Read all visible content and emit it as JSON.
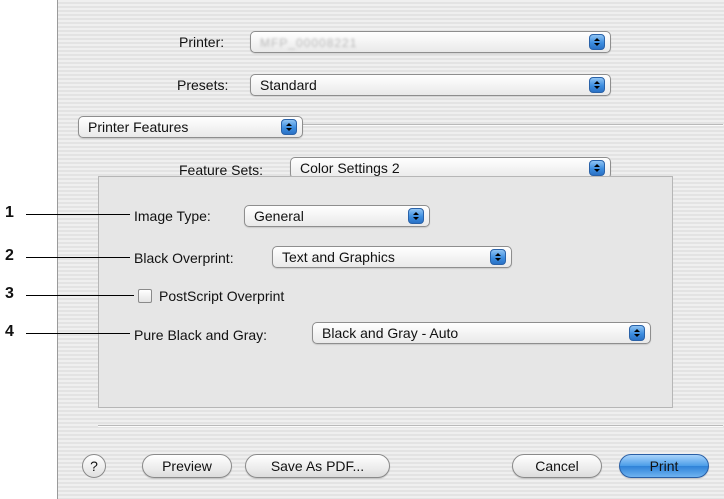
{
  "header": {
    "printer_label": "Printer:",
    "printer_value": "MFP_00008221",
    "presets_label": "Presets:",
    "presets_value": "Standard"
  },
  "panel_select": {
    "value": "Printer Features"
  },
  "feature_sets": {
    "label": "Feature Sets:",
    "value": "Color Settings 2"
  },
  "settings": {
    "image_type_label": "Image Type:",
    "image_type_value": "General",
    "black_overprint_label": "Black Overprint:",
    "black_overprint_value": "Text and Graphics",
    "postscript_overprint_label": "PostScript Overprint",
    "postscript_overprint_checked": false,
    "pure_black_label": "Pure Black and Gray:",
    "pure_black_value": "Black and Gray - Auto"
  },
  "callouts": [
    "1",
    "2",
    "3",
    "4"
  ],
  "footer": {
    "help_label": "?",
    "preview_label": "Preview",
    "save_pdf_label": "Save As PDF...",
    "cancel_label": "Cancel",
    "print_label": "Print"
  },
  "colors": {
    "accent": "#3d8ee0"
  }
}
